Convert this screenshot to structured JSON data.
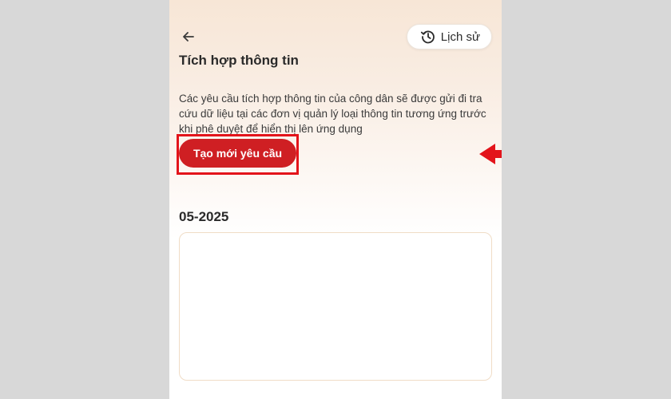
{
  "header": {
    "history_label": "Lịch sử"
  },
  "page": {
    "title": "Tích hợp thông tin",
    "description": "Các yêu cầu tích hợp thông tin của công dân sẽ được gửi đi tra cứu dữ liệu tại các đơn vị quản lý loại thông tin tương ứng trước khi phê duyệt để hiển thị lên ứng dụng",
    "create_button_label": "Tạo mới yêu cầu"
  },
  "requests": {
    "month_label": "05-2025"
  },
  "icons": {
    "back": "arrow-left-icon",
    "history": "history-clock-icon"
  },
  "colors": {
    "primary_red": "#cf1f23",
    "annotation_red": "#e3141b",
    "background_gray": "#d8d8d8"
  }
}
